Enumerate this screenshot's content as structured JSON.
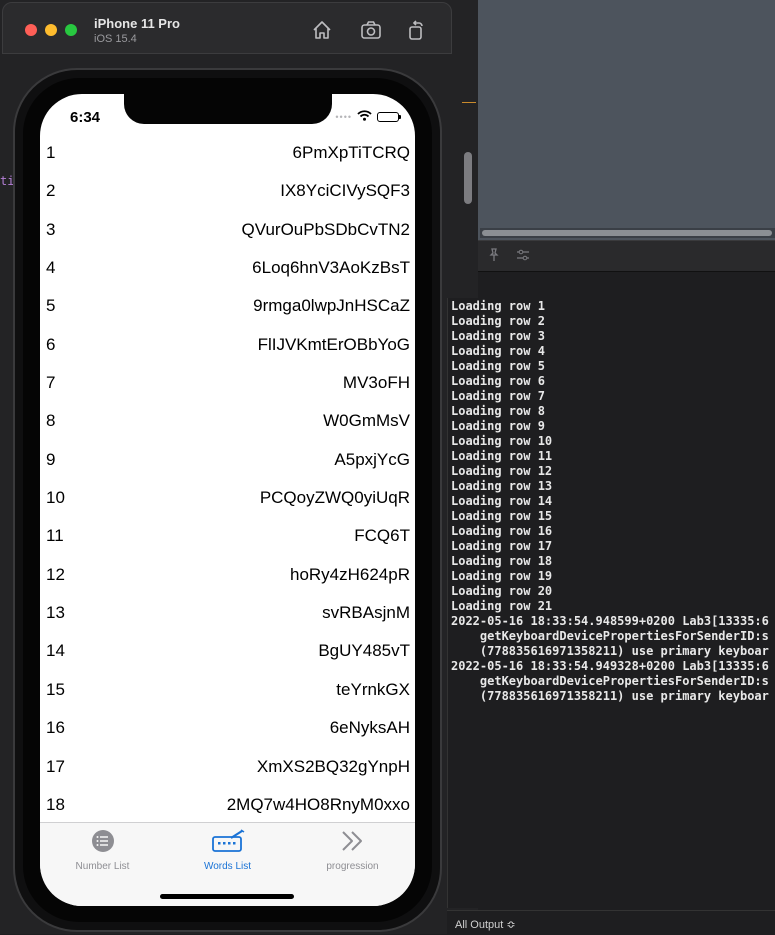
{
  "simulator": {
    "device_name": "iPhone 11 Pro",
    "os_version": "iOS 15.4",
    "toolbar_icons": [
      "home-icon",
      "screenshot-icon",
      "rotate-icon"
    ]
  },
  "status_bar": {
    "time": "6:34"
  },
  "words_list": {
    "rows": [
      {
        "num": "1",
        "word": "6PmXpTiTCRQ"
      },
      {
        "num": "2",
        "word": "IX8YciCIVySQF3"
      },
      {
        "num": "3",
        "word": "QVurOuPbSDbCvTN2"
      },
      {
        "num": "4",
        "word": "6Loq6hnV3AoKzBsT"
      },
      {
        "num": "5",
        "word": "9rmga0lwpJnHSCaZ"
      },
      {
        "num": "6",
        "word": "FlIJVKmtErOBbYoG"
      },
      {
        "num": "7",
        "word": "MV3oFH"
      },
      {
        "num": "8",
        "word": "W0GmMsV"
      },
      {
        "num": "9",
        "word": "A5pxjYcG"
      },
      {
        "num": "10",
        "word": "PCQoyZWQ0yiUqR"
      },
      {
        "num": "11",
        "word": "FCQ6T"
      },
      {
        "num": "12",
        "word": "hoRy4zH624pR"
      },
      {
        "num": "13",
        "word": "svRBAsjnM"
      },
      {
        "num": "14",
        "word": "BgUY485vT"
      },
      {
        "num": "15",
        "word": "teYrnkGX"
      },
      {
        "num": "16",
        "word": "6eNyksAH"
      },
      {
        "num": "17",
        "word": "XmXS2BQ32gYnpH"
      },
      {
        "num": "18",
        "word": "2MQ7w4HO8RnyM0xxo"
      }
    ]
  },
  "tab_bar": {
    "tabs": [
      {
        "label": "Number List",
        "icon": "list-icon",
        "selected": false
      },
      {
        "label": "Words List",
        "icon": "keyboard-icon",
        "selected": true
      },
      {
        "label": "progression",
        "icon": "chevron-double-right-icon",
        "selected": false
      }
    ]
  },
  "console": {
    "text": "Loading row 1\nLoading row 2\nLoading row 3\nLoading row 4\nLoading row 5\nLoading row 6\nLoading row 7\nLoading row 8\nLoading row 9\nLoading row 10\nLoading row 11\nLoading row 12\nLoading row 13\nLoading row 14\nLoading row 15\nLoading row 16\nLoading row 17\nLoading row 18\nLoading row 19\nLoading row 20\nLoading row 21\n2022-05-16 18:33:54.948599+0200 Lab3[13335:6\n    getKeyboardDevicePropertiesForSenderID:s\n    (778835616971358211) use primary keyboar\n2022-05-16 18:33:54.949328+0200 Lab3[13335:6\n    getKeyboardDevicePropertiesForSenderID:s\n    (778835616971358211) use primary keyboar",
    "filter_label": "All Output ≎"
  },
  "colors": {
    "tab_selected": "#1a73d6",
    "tab_unselected": "#8e8e93"
  }
}
